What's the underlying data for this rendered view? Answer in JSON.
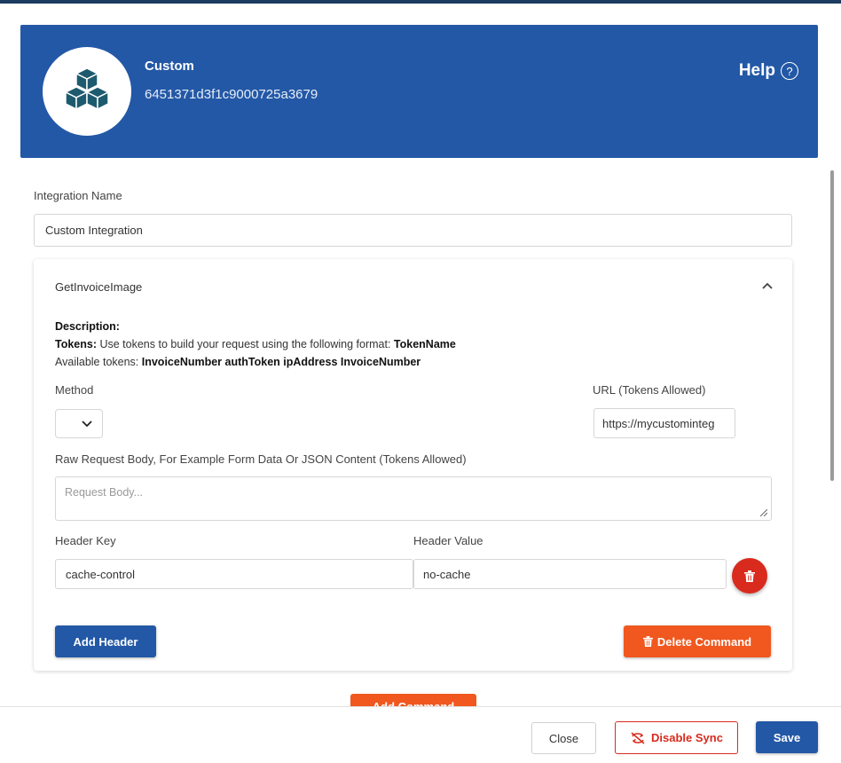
{
  "colors": {
    "brand_blue": "#2358a6",
    "accent_orange": "#f0581f",
    "danger_red": "#d82a1d"
  },
  "header": {
    "app_name": "Custom",
    "app_id": "6451371d3f1c9000725a3679",
    "help_label": "Help",
    "logo_icon": "cubes-icon",
    "help_icon": "question-circle-icon"
  },
  "integration": {
    "name_label": "Integration Name",
    "name_value": "Custom Integration"
  },
  "command": {
    "title": "GetInvoiceImage",
    "description_label": "Description:",
    "tokens_label": "Tokens:",
    "tokens_text": " Use tokens to build your request using the following format: ",
    "tokens_format": "TokenName",
    "available_label": "Available tokens: ",
    "available_tokens": "InvoiceNumber authToken ipAddress InvoiceNumber",
    "method_label": "Method",
    "method_value": "",
    "url_label": "URL (Tokens Allowed)",
    "url_value": "https://mycustominteg",
    "body_label": "Raw Request Body, For Example Form Data Or JSON Content (Tokens Allowed)",
    "body_placeholder": "Request Body...",
    "header_key_label": "Header Key",
    "header_key_value": "cache-control",
    "header_value_label": "Header Value",
    "header_value_value": "no-cache",
    "add_header_label": "Add Header",
    "delete_command_label": "Delete Command"
  },
  "add_command_label": "Add Command",
  "footer": {
    "close_label": "Close",
    "disable_sync_label": "Disable Sync",
    "save_label": "Save"
  }
}
